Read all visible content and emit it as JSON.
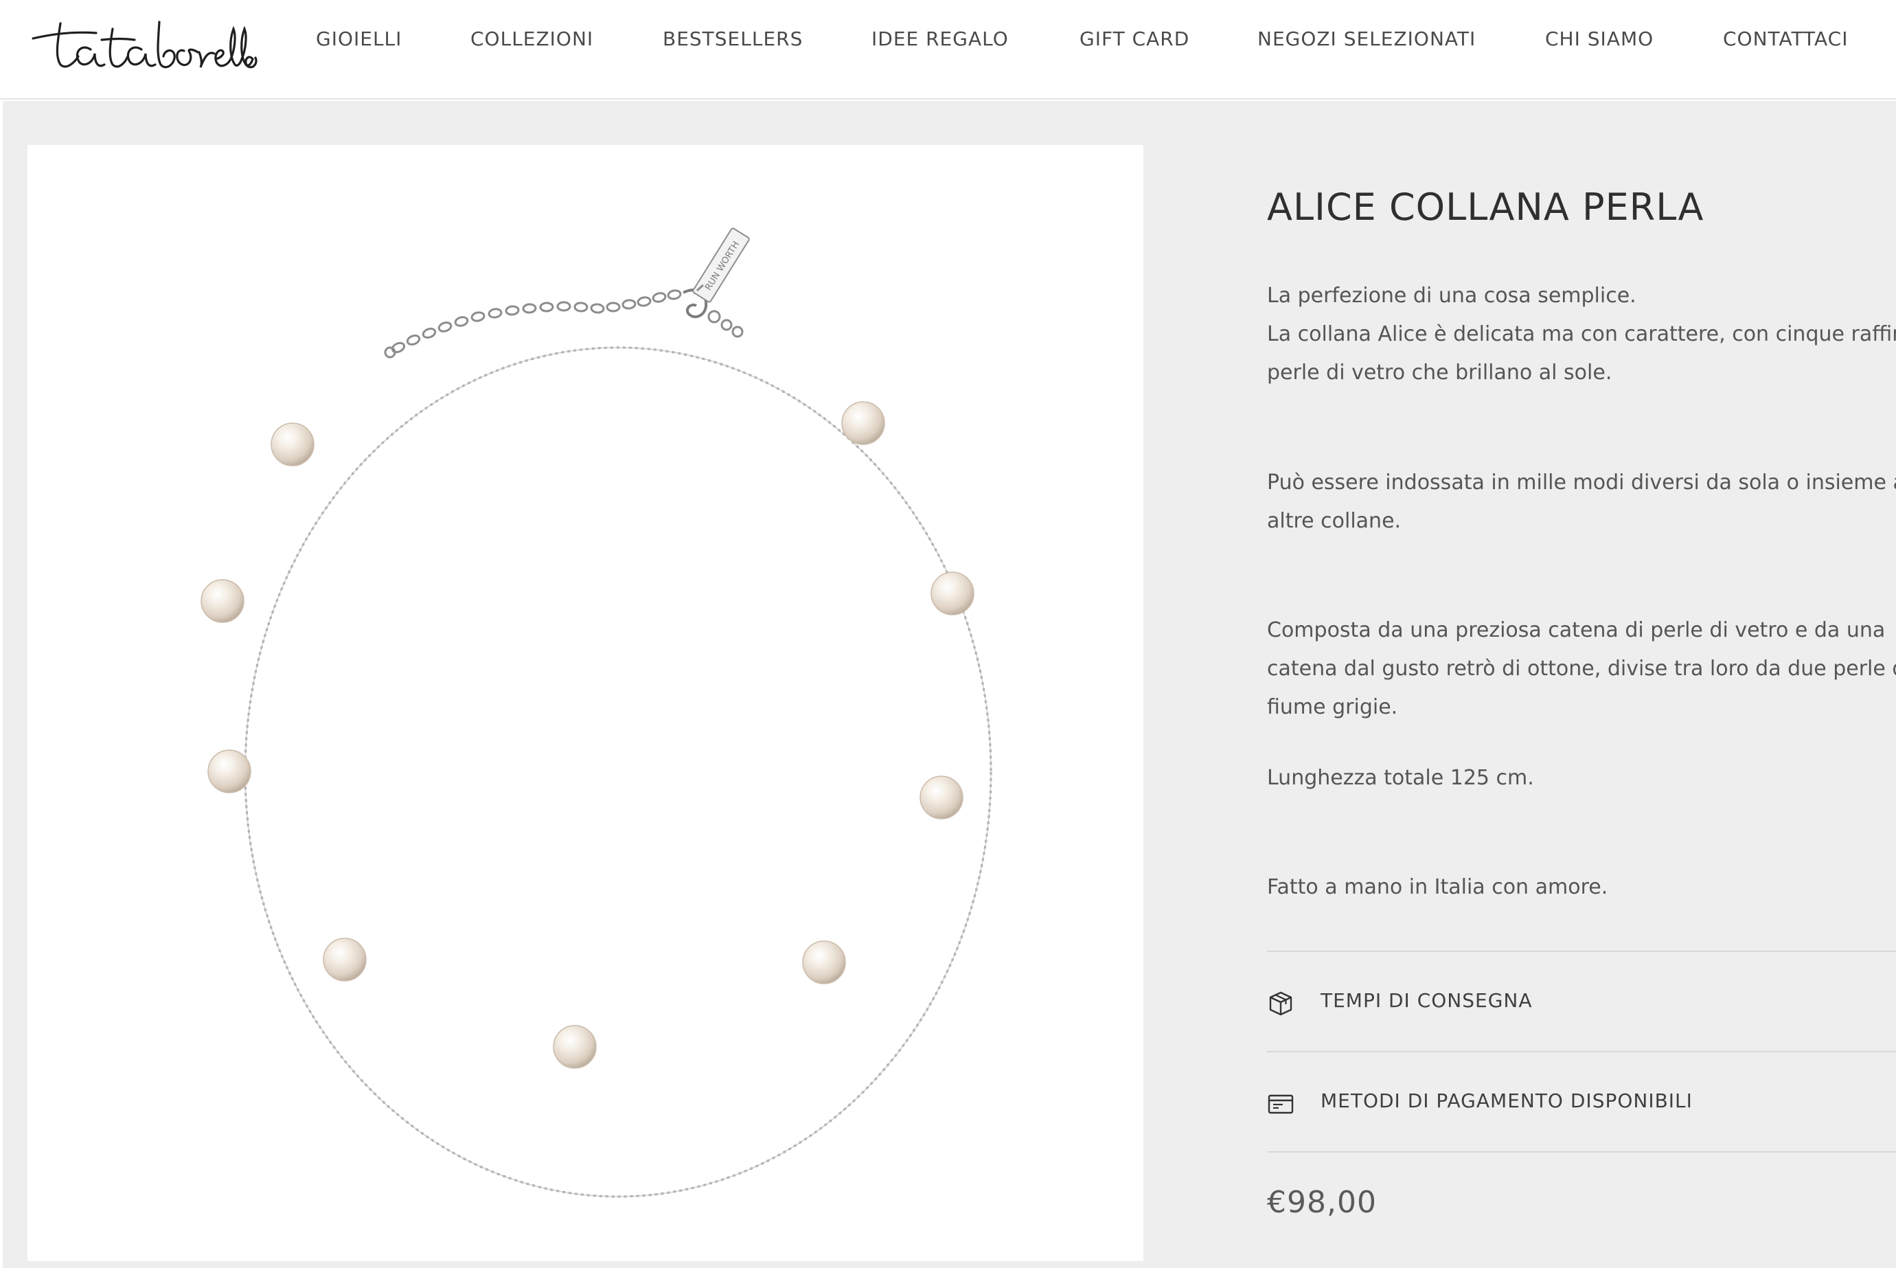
{
  "brand": {
    "logo_text": "tatabonello"
  },
  "nav": {
    "items": [
      {
        "label": "GIOIELLI"
      },
      {
        "label": "COLLEZIONI"
      },
      {
        "label": "BESTSELLERS"
      },
      {
        "label": "IDEE REGALO"
      },
      {
        "label": "GIFT CARD"
      },
      {
        "label": "NEGOZI SELEZIONATI"
      },
      {
        "label": "CHI SIAMO"
      },
      {
        "label": "CONTATTACI"
      }
    ]
  },
  "gallery": {
    "image_alt": "Collana di perle con catena argentata",
    "tag_text": "RUN WORTH"
  },
  "product": {
    "title": "ALICE COLLANA PERLA",
    "description": [
      {
        "lines": [
          "La perfezione di una cosa semplice.",
          "La collana Alice è delicata ma con carattere, con cinque raffin",
          "perle di vetro che brillano al sole."
        ]
      },
      {
        "lines": [
          "Può essere indossata in mille modi diversi da sola o insieme a",
          "altre collane."
        ]
      },
      {
        "lines": [
          "Composta da una preziosa catena di perle di vetro e da una",
          "catena dal gusto retrò di ottone, divise tra loro da due perle d",
          "fiume grigie."
        ]
      },
      {
        "lines": [
          "Lunghezza totale 125 cm."
        ]
      },
      {
        "lines": [
          "Fatto a mano in Italia con amore."
        ]
      }
    ],
    "accordions": [
      {
        "label": "TEMPI DI CONSEGNA",
        "icon": "package-icon"
      },
      {
        "label": "METODI DI PAGAMENTO DISPONIBILI",
        "icon": "credit-card-icon"
      }
    ],
    "price": "€98,00"
  },
  "colors": {
    "background": "#eeeeee",
    "text": "#555555",
    "title": "#2f2f2f",
    "divider": "#d8d8d8",
    "pearl": "#efe6dc"
  }
}
